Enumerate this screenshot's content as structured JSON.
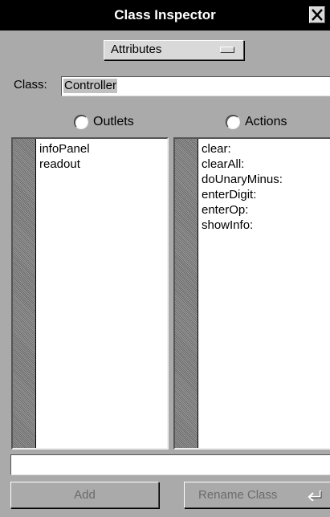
{
  "window": {
    "title": "Class Inspector",
    "close_icon": "close-x-icon"
  },
  "popup": {
    "selected": "Attributes"
  },
  "class_row": {
    "label": "Class:",
    "value": "Controller"
  },
  "outlets": {
    "radio_label": "Outlets",
    "selected": false,
    "items": [
      "infoPanel",
      "readout"
    ]
  },
  "actions": {
    "radio_label": "Actions",
    "selected": false,
    "items": [
      "clear:",
      "clearAll:",
      "doUnaryMinus:",
      "enterDigit:",
      "enterOp:",
      "showInfo:"
    ]
  },
  "name_field": {
    "value": ""
  },
  "buttons": {
    "add_label": "Add",
    "rename_label": "Rename Class",
    "rename_icon": "return-arrow-icon",
    "enabled": false
  }
}
